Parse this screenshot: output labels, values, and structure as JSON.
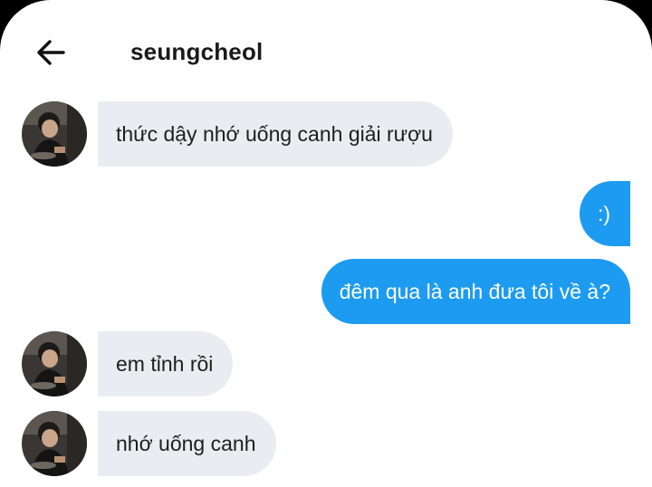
{
  "header": {
    "title": "seungcheol",
    "back_icon": "arrow-left-icon"
  },
  "colors": {
    "outgoing_bubble": "#1d9bf0",
    "incoming_bubble": "#e9ecf0"
  },
  "messages": [
    {
      "direction": "incoming",
      "text": "thức dậy nhớ uống canh giải rượu"
    },
    {
      "direction": "outgoing",
      "text": ":)"
    },
    {
      "direction": "outgoing",
      "text": "đêm qua là anh đưa tôi về à?"
    },
    {
      "direction": "incoming",
      "text": "em tỉnh rồi"
    },
    {
      "direction": "incoming",
      "text": "nhớ uống canh"
    }
  ]
}
